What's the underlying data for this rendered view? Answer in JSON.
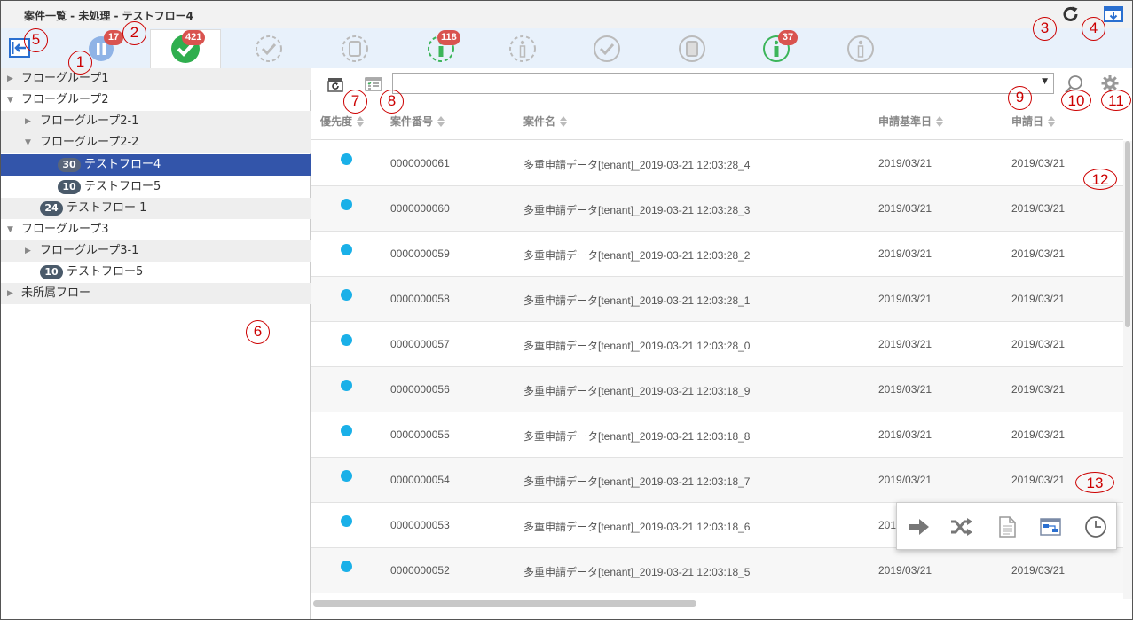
{
  "window": {
    "title": "案件一覧 - 未処理 - テストフロー4"
  },
  "status_bar": {
    "pending_badge": "17",
    "unprocessed_badge": "421",
    "info_badge_1": "118",
    "info_badge_2": "37"
  },
  "tree": {
    "items": [
      {
        "label": "フローグループ1"
      },
      {
        "label": "フローグループ2"
      },
      {
        "label": "フローグループ2-1"
      },
      {
        "label": "フローグループ2-2"
      },
      {
        "label": "テストフロー4",
        "count": "30"
      },
      {
        "label": "テストフロー5",
        "count": "10"
      },
      {
        "label": "テストフロー 1",
        "count": "24"
      },
      {
        "label": "フローグループ3"
      },
      {
        "label": "フローグループ3-1"
      },
      {
        "label": "テストフロー5",
        "count": "10"
      },
      {
        "label": "未所属フロー"
      }
    ]
  },
  "table": {
    "columns": [
      "優先度",
      "案件番号",
      "案件名",
      "申請基準日",
      "申請日"
    ],
    "rows": [
      {
        "number": "0000000061",
        "name": "多重申請データ[tenant]_2019-03-21 12:03:28_4",
        "base_date": "2019/03/21",
        "date": "2019/03/21"
      },
      {
        "number": "0000000060",
        "name": "多重申請データ[tenant]_2019-03-21 12:03:28_3",
        "base_date": "2019/03/21",
        "date": "2019/03/21"
      },
      {
        "number": "0000000059",
        "name": "多重申請データ[tenant]_2019-03-21 12:03:28_2",
        "base_date": "2019/03/21",
        "date": "2019/03/21"
      },
      {
        "number": "0000000058",
        "name": "多重申請データ[tenant]_2019-03-21 12:03:28_1",
        "base_date": "2019/03/21",
        "date": "2019/03/21"
      },
      {
        "number": "0000000057",
        "name": "多重申請データ[tenant]_2019-03-21 12:03:28_0",
        "base_date": "2019/03/21",
        "date": "2019/03/21"
      },
      {
        "number": "0000000056",
        "name": "多重申請データ[tenant]_2019-03-21 12:03:18_9",
        "base_date": "2019/03/21",
        "date": "2019/03/21"
      },
      {
        "number": "0000000055",
        "name": "多重申請データ[tenant]_2019-03-21 12:03:18_8",
        "base_date": "2019/03/21",
        "date": "2019/03/21"
      },
      {
        "number": "0000000054",
        "name": "多重申請データ[tenant]_2019-03-21 12:03:18_7",
        "base_date": "2019/03/21",
        "date": "2019/03/21"
      },
      {
        "number": "0000000053",
        "name": "多重申請データ[tenant]_2019-03-21 12:03:18_6",
        "base_date": "201",
        "date": ""
      },
      {
        "number": "0000000052",
        "name": "多重申請データ[tenant]_2019-03-21 12:03:18_5",
        "base_date": "2019/03/21",
        "date": "2019/03/21"
      }
    ]
  },
  "callouts": [
    "1",
    "2",
    "3",
    "4",
    "5",
    "6",
    "7",
    "8",
    "9",
    "10",
    "11",
    "12",
    "13"
  ],
  "colors": {
    "accent_blue": "#2a6fd0",
    "selected_row": "#3355aa",
    "priority_dot": "#1ab0e8",
    "badge_red": "#d9534f",
    "callout_red": "#cc0000"
  }
}
